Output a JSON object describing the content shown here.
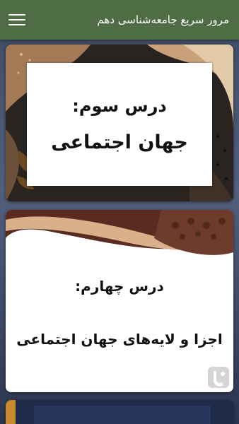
{
  "app": {
    "title": "مرور سریع جامعه‌شناسی دهم",
    "menu_icon": "hamburger-menu-icon",
    "appbar_color": "#4f6d45"
  },
  "lessons": [
    {
      "number": "درس سوم:",
      "title": "جهان اجتماعی"
    },
    {
      "number": "درس چهارم:",
      "title": "اجزا و لایه‌های جهان اجتماعی"
    }
  ]
}
